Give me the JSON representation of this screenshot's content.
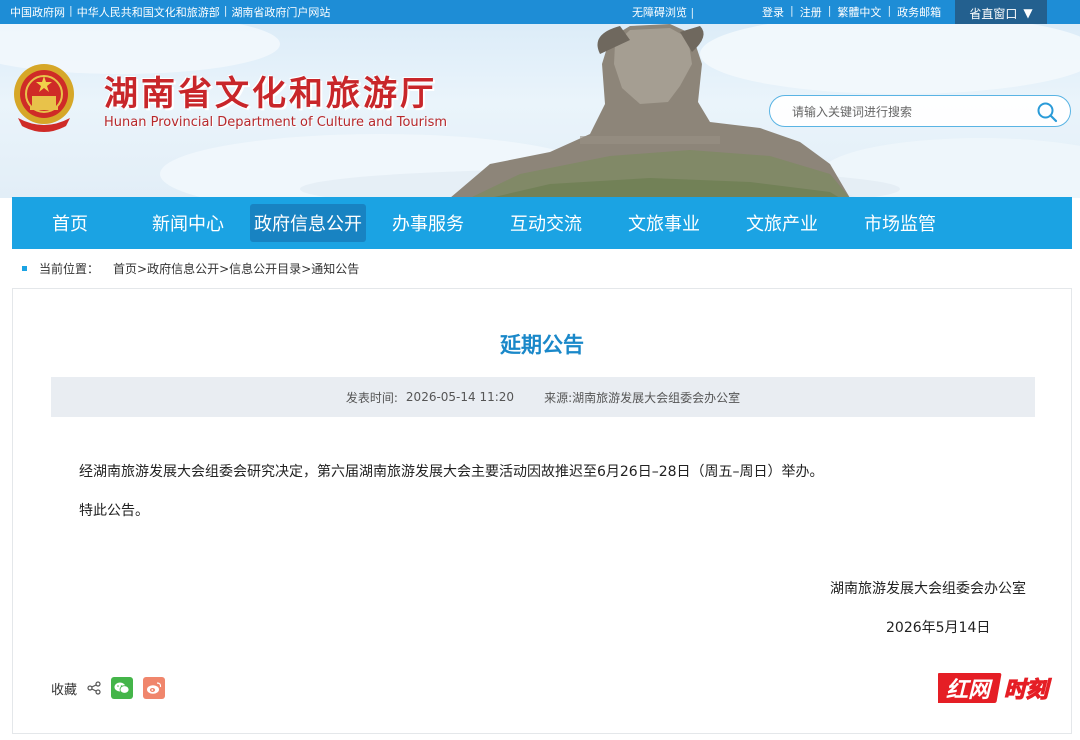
{
  "topbar": {
    "links_left": [
      "中国政府网",
      "中华人民共和国文化和旅游部",
      "湖南省政府门户网站"
    ],
    "accessibility": "无障碍浏览",
    "links_right": [
      "登录",
      "注册",
      "繁體中文",
      "政务邮箱"
    ],
    "window_button": "省直窗口",
    "window_arrow": "▼"
  },
  "header": {
    "title_cn": "湖南省文化和旅游厅",
    "title_en": "Hunan Provincial Department of Culture and Tourism",
    "search_placeholder": "请输入关键词进行搜索"
  },
  "nav": {
    "items": [
      "首页",
      "新闻中心",
      "政府信息公开",
      "办事服务",
      "互动交流",
      "文旅事业",
      "文旅产业",
      "市场监管"
    ],
    "active": "政府信息公开"
  },
  "breadcrumb": {
    "label": "当前位置：",
    "items": [
      "首页",
      "政府信息公开",
      "信息公开目录",
      "通知公告"
    ],
    "separator": ">"
  },
  "article": {
    "title": "延期公告",
    "publish_label": "发表时间:",
    "publish_time": "2026-05-14 11:20",
    "source": "来源:湖南旅游发展大会组委会办公室",
    "paragraphs": [
      "经湖南旅游发展大会组委会研究决定，第六届湖南旅游发展大会主要活动因故推迟至6月26日–28日（周五–周日）举办。",
      "特此公告。"
    ],
    "signature": "湖南旅游发展大会组委会办公室",
    "date": "2026年5月14日"
  },
  "share": {
    "favorite": "收藏"
  },
  "watermark": "红网时刻"
}
